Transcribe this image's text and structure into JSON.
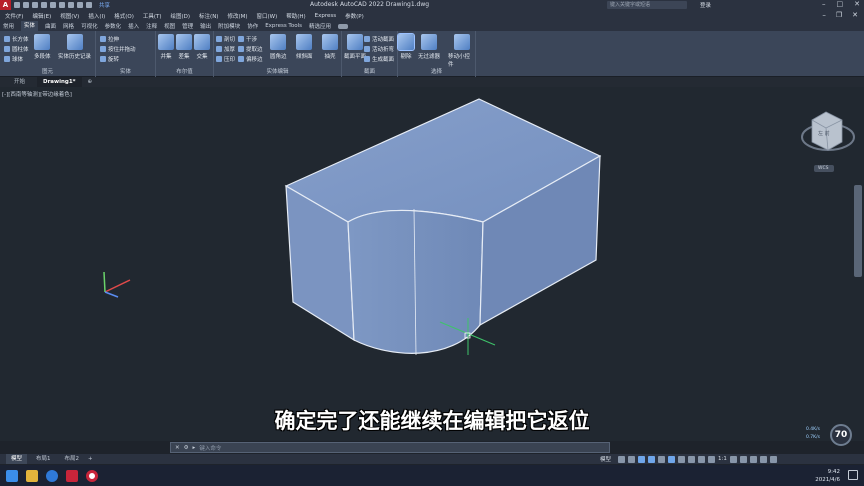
{
  "titlebar": {
    "app_logo": "A",
    "share_label": "共享",
    "title": "Autodesk AutoCAD 2022   Drawing1.dwg",
    "search_placeholder": "键入关键字或短语",
    "user_label": "登录"
  },
  "menu": [
    "文件(F)",
    "编辑(E)",
    "视图(V)",
    "插入(I)",
    "格式(O)",
    "工具(T)",
    "绘图(D)",
    "标注(N)",
    "修改(M)",
    "窗口(W)",
    "帮助(H)",
    "Express",
    "参数(P)"
  ],
  "ribbon_tabs": [
    {
      "label": "常用",
      "active": false
    },
    {
      "label": "实体",
      "active": true
    },
    {
      "label": "曲面",
      "active": false
    },
    {
      "label": "网格",
      "active": false
    },
    {
      "label": "可视化",
      "active": false
    },
    {
      "label": "参数化",
      "active": false
    },
    {
      "label": "插入",
      "active": false
    },
    {
      "label": "注释",
      "active": false
    },
    {
      "label": "视图",
      "active": false
    },
    {
      "label": "管理",
      "active": false
    },
    {
      "label": "输出",
      "active": false
    },
    {
      "label": "附加模块",
      "active": false
    },
    {
      "label": "协作",
      "active": false
    },
    {
      "label": "Express Tools",
      "active": false
    },
    {
      "label": "精选应用",
      "active": false
    }
  ],
  "ribbon": {
    "primitive": {
      "label": "图元",
      "small": [
        "长方体",
        "圆柱体",
        "球体"
      ],
      "big": [
        "多段体",
        "实体历史记录"
      ]
    },
    "solid": {
      "label": "实体",
      "small": [
        "拉伸",
        "放样",
        "旋转"
      ],
      "big": [
        "扫掠"
      ],
      "small2": [
        "按住并拖动",
        "旋转"
      ]
    },
    "boolean": {
      "label": "布尔值",
      "big": [
        "并集",
        "差集",
        "交集"
      ]
    },
    "solid_edit": {
      "label": "实体编辑",
      "small": [
        "剖切",
        "加厚",
        "压印"
      ],
      "small2": [
        "干涉",
        "提取边",
        "偏移边"
      ],
      "big": [
        "圆角边",
        "倾斜面",
        "抽壳"
      ]
    },
    "section": {
      "label": "截面",
      "big": [
        "截面平面"
      ],
      "small": [
        "活动截面",
        "活动折弯",
        "生成截面"
      ]
    },
    "selection": {
      "label": "选择",
      "big": [
        "剔除",
        "无过滤器",
        "移动小控件"
      ]
    }
  },
  "file_tabs": [
    {
      "label": "开始",
      "active": false
    },
    {
      "label": "Drawing1*",
      "active": true
    }
  ],
  "viewport": {
    "label": "[-][西南等轴测][带边缘着色]",
    "viewcube_wcs": "WCS",
    "viewcube_face": "左 前"
  },
  "subtitle": "确定完了还能继续在编辑把它返位",
  "widget": {
    "speed_up": "0.4K/s",
    "speed_down": "0.7K/s",
    "percent": "70"
  },
  "command_line": {
    "placeholder": "键入命令"
  },
  "layout_tabs": [
    {
      "label": "模型",
      "active": true
    },
    {
      "label": "布局1",
      "active": false
    },
    {
      "label": "布局2",
      "active": false
    }
  ],
  "status": {
    "model_label": "模型",
    "scale": "1:1"
  },
  "taskbar": {
    "time": "9:42",
    "date": "2021/4/6"
  },
  "colors": {
    "solid_face": "#7d96c2",
    "background": "#212830",
    "ribbon": "#3b4659"
  }
}
